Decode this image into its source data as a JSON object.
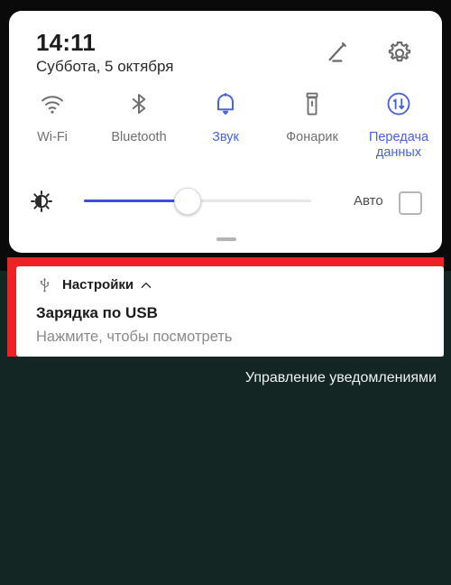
{
  "theme": {
    "background": "#132623",
    "frame": "#0a0a0a",
    "panel_bg": "#ffffff",
    "accent_blue": "#4a63d8",
    "inactive_gray": "#6f6f6f",
    "highlight_red": "#ec2227"
  },
  "quick_settings": {
    "clock": "14:11",
    "date": "Суббота, 5 октября",
    "edit_icon": "pencil-edit-icon",
    "settings_icon": "gear-icon",
    "tiles": [
      {
        "label": "Wi-Fi",
        "icon": "wifi-icon",
        "state": "off"
      },
      {
        "label": "Bluetooth",
        "icon": "bluetooth-icon",
        "state": "off"
      },
      {
        "label": "Звук",
        "icon": "bell-sound-icon",
        "state": "on"
      },
      {
        "label": "Фонарик",
        "icon": "flashlight-icon",
        "state": "off"
      },
      {
        "label": "Передача данных",
        "icon": "data-transfer-icon",
        "state": "on"
      }
    ],
    "brightness": {
      "icon": "brightness-sun-icon",
      "value_percent": 46,
      "auto_label": "Авто",
      "auto_checked": false
    },
    "drag_handle": "panel-drag-handle"
  },
  "notification": {
    "app_icon": "usb-icon",
    "app_name": "Настройки",
    "expand_icon": "chevron-up-icon",
    "title": "Зарядка по USB",
    "subtitle": "Нажмите, чтобы посмотреть"
  },
  "footer": {
    "manage_label": "Управление уведомлениями"
  }
}
